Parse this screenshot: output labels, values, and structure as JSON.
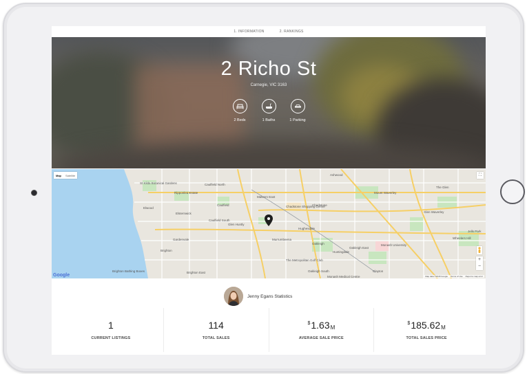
{
  "nav": {
    "items": [
      {
        "label": "1. INFORMATION"
      },
      {
        "label": "2. RANKINGS"
      }
    ]
  },
  "hero": {
    "title": "2 Richo St",
    "subtitle": "Carnegie, VIC 3163",
    "features": [
      {
        "icon": "bed-icon",
        "label": "2 Beds"
      },
      {
        "icon": "bath-icon",
        "label": "1 Baths"
      },
      {
        "icon": "car-icon",
        "label": "1 Parking"
      }
    ]
  },
  "map": {
    "type_map": "Map",
    "type_satellite": "Satellite",
    "google": "Google",
    "attribution": "Map data ©2018 Google",
    "terms": "Terms of Use",
    "report": "Report a map error",
    "labels": [
      "St Kilda Botanical Gardens",
      "Ripponlea Estate",
      "Caulfield North",
      "Elsternwick",
      "Elwood",
      "Malvern East",
      "Ashwood",
      "Mount Waverley",
      "The Glen",
      "Chadstone Shopping Centre",
      "Chadstone",
      "Caulfield South",
      "Glen Huntly",
      "Hughesdale",
      "Glen Waverley",
      "Gardenvale",
      "Murrumbeena",
      "Oakleigh",
      "Huntingdale",
      "Oakleigh East",
      "Monash University",
      "Brighton",
      "The Metropolitan Golf Club",
      "Brighton East",
      "Oakleigh South",
      "Clayton",
      "Wheelers Hill",
      "Jells Park",
      "Brighton Bathing Boxes",
      "Monash Medical Centre",
      "Caulfield"
    ]
  },
  "agent": {
    "name": "Jenny Egans Statistics"
  },
  "stats": [
    {
      "value": "1",
      "prefix": "",
      "suffix": "",
      "label": "CURRENT LISTINGS"
    },
    {
      "value": "114",
      "prefix": "",
      "suffix": "",
      "label": "TOTAL SALES"
    },
    {
      "value": "1.63",
      "prefix": "$",
      "suffix": "M",
      "label": "AVERAGE SALE PRICE"
    },
    {
      "value": "185.62",
      "prefix": "$",
      "suffix": "M",
      "label": "TOTAL SALES PRICE"
    }
  ]
}
